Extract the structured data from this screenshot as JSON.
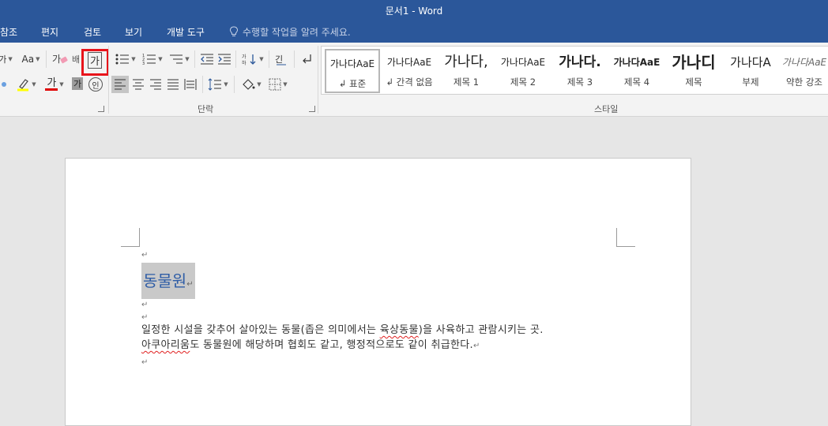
{
  "window": {
    "title": "문서1 - Word"
  },
  "menu": {
    "tabs": [
      {
        "label": "참조"
      },
      {
        "label": "편지"
      },
      {
        "label": "검토"
      },
      {
        "label": "보기"
      },
      {
        "label": "개발 도구"
      }
    ],
    "tell_me_placeholder": "수행할 작업을 알려 주세요."
  },
  "ribbon": {
    "font": {
      "partial_label": "가",
      "change_case_label": "Aa",
      "char_shading_label": "가",
      "char_border_label": "가",
      "phonetic_label": "배",
      "font_color_label": "가",
      "enclose_label": "인",
      "colors": {
        "highlight": "#ffff00",
        "font_color": "#e00000",
        "active_box": "#e8141b"
      }
    },
    "paragraph": {
      "group_label": "단락"
    },
    "styles": {
      "group_label": "스타일",
      "items": [
        {
          "preview": "가나다AaE",
          "name": "↲ 표준",
          "selected": true
        },
        {
          "preview": "가나다AaE",
          "name": "↲ 간격 없음",
          "selected": false
        },
        {
          "preview": "가나다,",
          "name": "제목 1",
          "selected": false
        },
        {
          "preview": "가나다AaE",
          "name": "제목 2",
          "selected": false
        },
        {
          "preview": "가나다.",
          "name": "제목 3",
          "selected": false
        },
        {
          "preview": "가나다AaE",
          "name": "제목 4",
          "selected": false
        },
        {
          "preview": "가나디",
          "name": "제목",
          "selected": false
        },
        {
          "preview": "가나다A",
          "name": "부제",
          "selected": false
        },
        {
          "preview": "가나다AaE",
          "name": "약한 강조",
          "selected": false
        }
      ]
    }
  },
  "document": {
    "paragraph_mark": "↵",
    "heading": "동물원",
    "body_line1": "일정한 시설을 갖추어 살아있는 동물(좁은 의미에서는 육상동물)을 사육하고 관람시키는 곳.",
    "body_line2_part1": "아쿠아리움",
    "body_line2_part2": "도 동물원에 해당하며 협회도 같고, 행정적으로도 같이 취급한다.",
    "misspelled_word": "육상동물"
  }
}
